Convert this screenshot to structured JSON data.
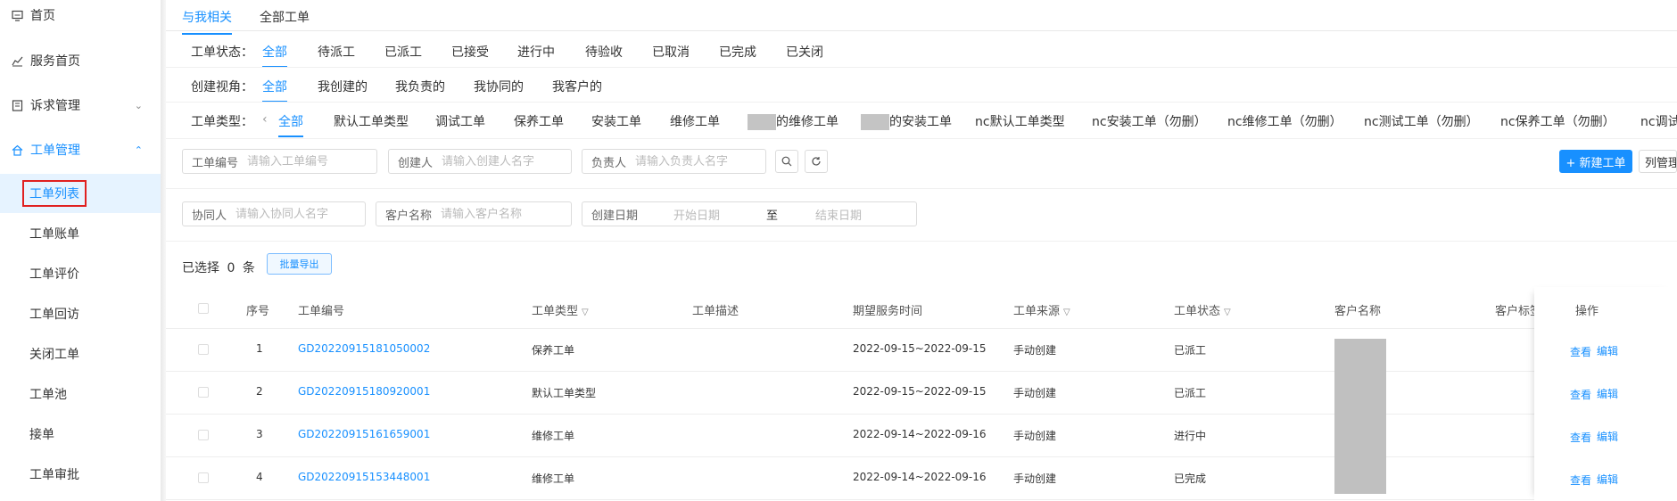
{
  "sidebar": {
    "items": [
      {
        "label": "首页",
        "icon": "monitor-icon"
      },
      {
        "label": "服务首页",
        "icon": "chart-line-icon"
      },
      {
        "label": "诉求管理",
        "icon": "doc-icon"
      },
      {
        "label": "工单管理",
        "icon": "home-icon"
      }
    ],
    "sub_items": [
      "工单列表",
      "工单账单",
      "工单评价",
      "工单回访",
      "关闭工单",
      "工单池",
      "接单",
      "工单审批"
    ]
  },
  "tabs": [
    "与我相关",
    "全部工单"
  ],
  "filters": {
    "status": {
      "label": "工单状态：",
      "options": [
        "全部",
        "待派工",
        "已派工",
        "已接受",
        "进行中",
        "待验收",
        "已取消",
        "已完成",
        "已关闭"
      ]
    },
    "view": {
      "label": "创建视角：",
      "options": [
        "全部",
        "我创建的",
        "我负责的",
        "我协同的",
        "我客户的"
      ]
    },
    "type": {
      "label": "工单类型：",
      "prev_arrow": "‹",
      "options": [
        "全部",
        "默认工单类型",
        "调试工单",
        "保养工单",
        "安装工单",
        "维修工单",
        "的维修工单",
        "的安装工单",
        "nc默认工单类型",
        "nc安装工单（勿删）",
        "nc维修工单（勿删）",
        "nc测试工单（勿删）",
        "nc保养工单（勿删）",
        "nc调试"
      ]
    }
  },
  "search": {
    "order_no": {
      "label": "工单编号",
      "placeholder": "请输入工单编号"
    },
    "creator": {
      "label": "创建人",
      "placeholder": "请输入创建人名字"
    },
    "owner": {
      "label": "负责人",
      "placeholder": "请输入负责人名字"
    },
    "collaborator": {
      "label": "协同人",
      "placeholder": "请输入协同人名字"
    },
    "customer": {
      "label": "客户名称",
      "placeholder": "请输入客户名称"
    },
    "create_date": {
      "label": "创建日期",
      "start": "开始日期",
      "sep": "至",
      "end": "结束日期"
    }
  },
  "toolbar": {
    "new_button": "+ 新建工单",
    "column_manage": "列管理",
    "selected_prefix": "已选择",
    "selected_count": "0",
    "selected_suffix": "条",
    "batch_export": "批量导出"
  },
  "table": {
    "columns": [
      "序号",
      "工单编号",
      "工单类型",
      "工单描述",
      "期望服务时间",
      "工单来源",
      "工单状态",
      "客户名称",
      "客户标签",
      "操作"
    ],
    "rows": [
      {
        "index": "1",
        "order_no": "GD20220915181050002",
        "type": "保养工单",
        "desc": "",
        "time": "2022-09-15~2022-09-15",
        "source": "手动创建",
        "status": "已派工"
      },
      {
        "index": "2",
        "order_no": "GD20220915180920001",
        "type": "默认工单类型",
        "desc": "",
        "time": "2022-09-15~2022-09-15",
        "source": "手动创建",
        "status": "已派工"
      },
      {
        "index": "3",
        "order_no": "GD20220915161659001",
        "type": "维修工单",
        "desc": "",
        "time": "2022-09-14~2022-09-16",
        "source": "手动创建",
        "status": "进行中"
      },
      {
        "index": "4",
        "order_no": "GD20220915153448001",
        "type": "维修工单",
        "desc": "",
        "time": "2022-09-14~2022-09-16",
        "source": "手动创建",
        "status": "已完成"
      }
    ],
    "actions": {
      "view": "查看",
      "edit": "编辑"
    }
  },
  "colors": {
    "accent": "#1890ff",
    "highlight_border": "#e02020",
    "mask": "#c0c0c0"
  }
}
